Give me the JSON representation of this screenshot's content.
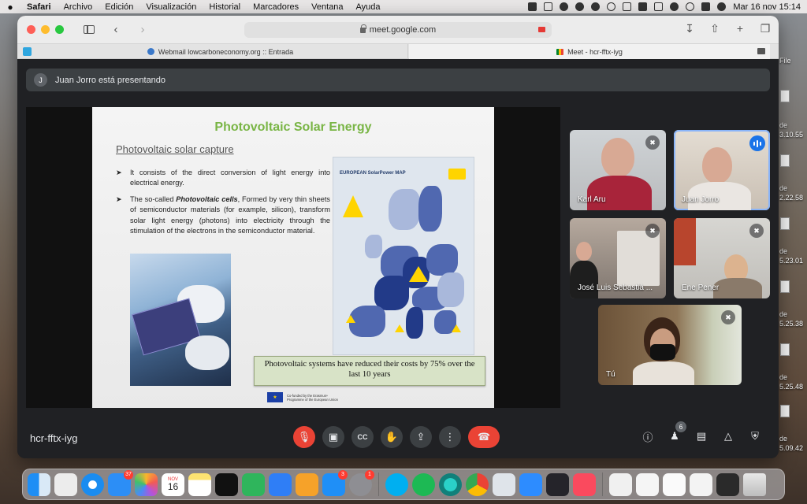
{
  "menubar": {
    "app": "Safari",
    "items": [
      "Archivo",
      "Edición",
      "Visualización",
      "Historial",
      "Marcadores",
      "Ventana",
      "Ayuda"
    ],
    "clock": "Mar 16 nov  15:14"
  },
  "browser": {
    "url": "meet.google.com",
    "tabs": [
      {
        "title": "Webmail lowcarboneconomy.org :: Entrada"
      },
      {
        "title": "Meet - hcr-fftx-iyg"
      }
    ]
  },
  "meet": {
    "presenter_initial": "J",
    "presenter_banner": "Juan Jorro está presentando",
    "meeting_code": "hcr-fftx-iyg",
    "participants_count": "6",
    "participants": [
      {
        "name": "Karl Aru"
      },
      {
        "name": "Juan Jorro"
      },
      {
        "name": "José Luis Sebastià ..."
      },
      {
        "name": "Ene Pener"
      },
      {
        "name": "Tú"
      }
    ]
  },
  "slide": {
    "title": "Photovoltaic Solar Energy",
    "subtitle": "Photovoltaic solar capture",
    "bullet1": "It consists of the direct conversion of light energy into electrical energy.",
    "bullet2_prefix": "The so-called ",
    "bullet2_emph": "Photovoltaic cells",
    "bullet2_rest": ", Formed by very thin sheets of semiconductor materials (for example, silicon), transform solar light energy (photons) into electricity through the stimulation of the electrons in the semiconductor material.",
    "map_title": "EUROPEAN SolarPower MAP",
    "caption": "Photovoltaic systems have reduced their costs by 75% over the last 10 years",
    "eu_text": "Co-funded by the Erasmus+ Programme of the European Union"
  },
  "desktop": {
    "labels": [
      "File",
      "de",
      "3.10.55",
      "de",
      "2.22.58",
      "de",
      "5.23.01",
      "de",
      "5.25.38",
      "de",
      "5.25.48",
      "de",
      "5.09.42"
    ]
  },
  "dock": {
    "badges": {
      "mail": "37",
      "appstore": "3",
      "settings": "1"
    },
    "calendar_month": "NOV",
    "calendar_day": "16"
  },
  "colors": {
    "meet_bg": "#202124",
    "end_call": "#ea4335",
    "slide_title": "#79b545",
    "speaking": "#1a73e8"
  }
}
